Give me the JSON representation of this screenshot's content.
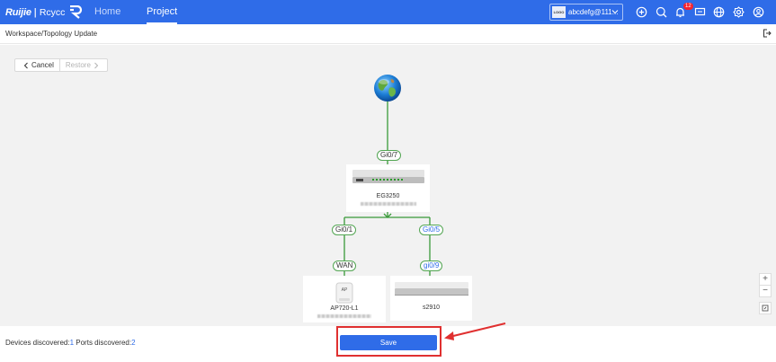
{
  "app": {
    "logo_brand": "Ruijie",
    "logo_sub": "Rcycc"
  },
  "nav": {
    "home": "Home",
    "project": "Project"
  },
  "account": {
    "logo_text": "LOGO",
    "name": "abcdefg@111..."
  },
  "notifications": {
    "count": "12"
  },
  "toolbar_icons": [
    "add-circle-icon",
    "search-icon",
    "bell-icon",
    "message-icon",
    "globe-icon",
    "gear-icon",
    "user-icon"
  ],
  "breadcrumb": "Workspace/Topology Update",
  "buttons": {
    "cancel": "Cancel",
    "restore": "Restore",
    "save": "Save"
  },
  "topology": {
    "internet_icon": "globe-icon",
    "root_port": "Gi0/7",
    "gateway": {
      "name": "EG3250"
    },
    "left_link": {
      "upstream_port": "Gi0/1",
      "downstream_port": "WAN"
    },
    "right_link": {
      "upstream_port": "Gi0/5",
      "downstream_port": "gi0/9"
    },
    "devices": [
      {
        "name": "AP720-L1",
        "badge": "AP"
      },
      {
        "name": "s2910"
      }
    ],
    "link_color": "#3a9a3a"
  },
  "zoom": {
    "in": "+",
    "out": "−"
  },
  "status": {
    "devices_label": "Devices discovered:",
    "devices_count": "1",
    "ports_label": " Ports discovered:",
    "ports_count": "2"
  },
  "colors": {
    "primary": "#2f6ce8",
    "highlight": "#e03030"
  }
}
